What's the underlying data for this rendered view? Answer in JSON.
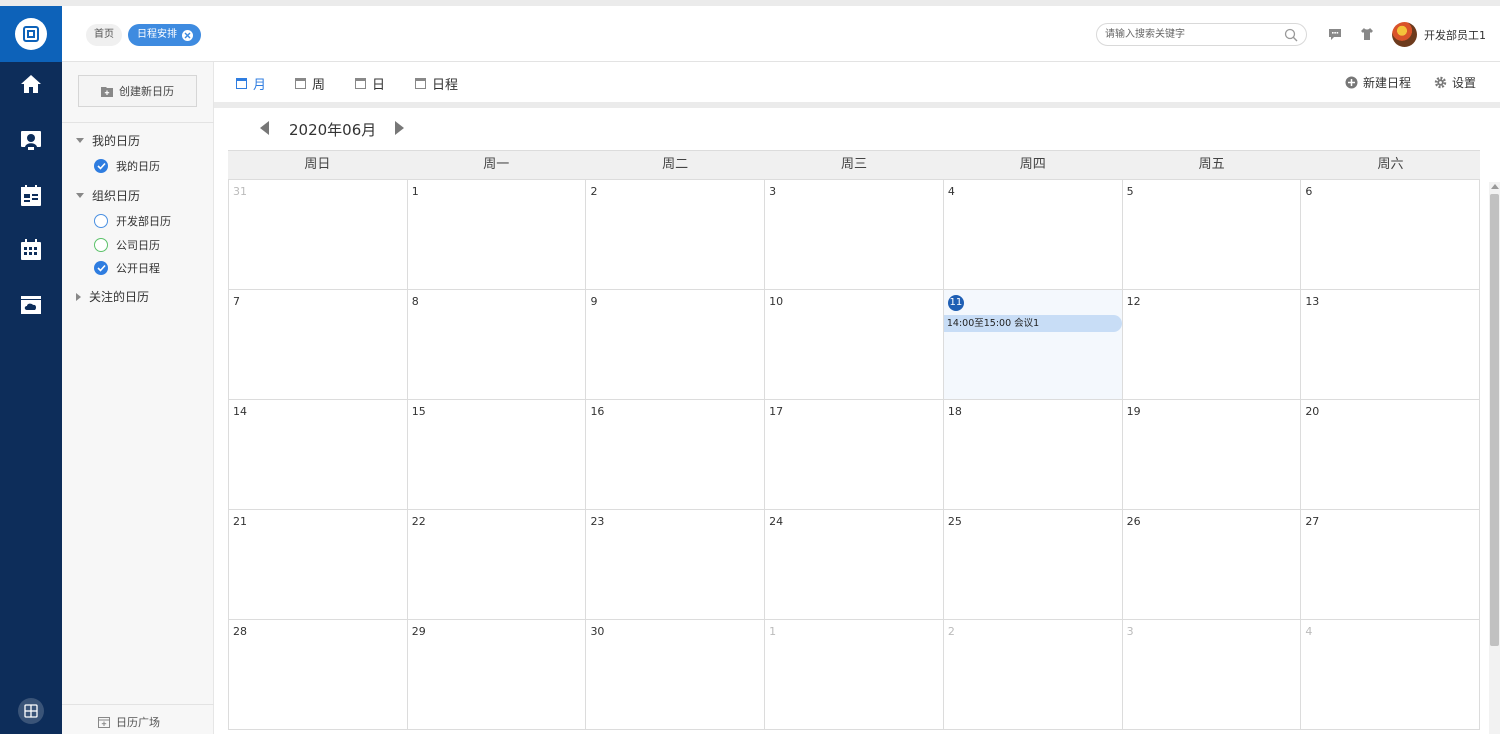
{
  "header": {
    "crumbs": {
      "home": "首页",
      "current": "日程安排"
    },
    "search": {
      "placeholder": "请输入搜索关键字"
    },
    "user": {
      "name": "开发部员工1"
    }
  },
  "sidebar": {
    "create_label": "创建新日历",
    "my_group": "我的日历",
    "my_items": [
      {
        "label": "我的日历",
        "checked": true
      }
    ],
    "org_group": "组织日历",
    "org_items": [
      {
        "label": "开发部日历",
        "checked": false,
        "color": "#4a90e2"
      },
      {
        "label": "公司日历",
        "checked": false,
        "color": "#5cc26a"
      },
      {
        "label": "公开日程",
        "checked": true,
        "color": "#2f7de0"
      }
    ],
    "follow_group": "关注的日历",
    "plaza_label": "日历广场"
  },
  "toolbar": {
    "views": [
      "月",
      "周",
      "日",
      "日程"
    ],
    "active_view": "月",
    "new_event_label": "新建日程",
    "settings_label": "设置"
  },
  "calendar": {
    "month_label": "2020年06月",
    "weekdays": [
      "周日",
      "周一",
      "周二",
      "周三",
      "周四",
      "周五",
      "周六"
    ],
    "weeks": [
      [
        "31",
        "1",
        "2",
        "3",
        "4",
        "5",
        "6"
      ],
      [
        "7",
        "8",
        "9",
        "10",
        "11",
        "12",
        "13"
      ],
      [
        "14",
        "15",
        "16",
        "17",
        "18",
        "19",
        "20"
      ],
      [
        "21",
        "22",
        "23",
        "24",
        "25",
        "26",
        "27"
      ],
      [
        "28",
        "29",
        "30",
        "1",
        "2",
        "3",
        "4"
      ]
    ],
    "today": "11",
    "event": {
      "text": "14:00至15:00  会议1"
    }
  },
  "colors": {
    "nav": "#0d2d5a",
    "accent": "#2f7de0",
    "event": "#c8ddf6"
  }
}
